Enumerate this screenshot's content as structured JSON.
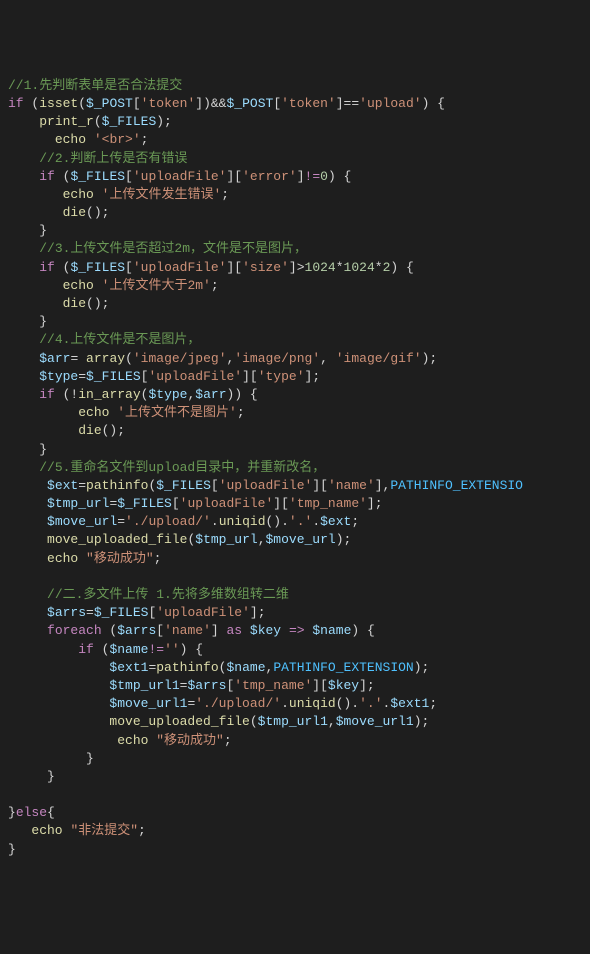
{
  "code": {
    "comments": {
      "c1": "//1.先判断表单是否合法提交",
      "c2": "//2.判断上传是否有错误",
      "c3": "//3.上传文件是否超过2m，文件是不是图片，",
      "c4": "//4.上传文件是不是图片，",
      "c5": "//5.重命名文件到upload目录中，并重新改名，",
      "c6": "//二.多文件上传 1.先将多维数组转二维"
    },
    "kw": {
      "if": "if",
      "else": "else",
      "foreach": "foreach",
      "as": "as",
      "arrow": "=>",
      "noteq": "!="
    },
    "fn": {
      "isset": "isset",
      "print_r": "print_r",
      "echo": "echo",
      "die": "die",
      "array": "array",
      "in_array": "in_array",
      "pathinfo": "pathinfo",
      "uniqid": "uniqid",
      "move_uploaded_file": "move_uploaded_file"
    },
    "vars": {
      "post": "$_POST",
      "files": "$_FILES",
      "arr": "$arr",
      "type": "$type",
      "ext": "$ext",
      "tmp_url": "$tmp_url",
      "move_url": "$move_url",
      "arrs": "$arrs",
      "key": "$key",
      "name": "$name",
      "ext1": "$ext1",
      "tmp_url1": "$tmp_url1",
      "move_url1": "$move_url1"
    },
    "str": {
      "token": "'token'",
      "upload": "'upload'",
      "br": "'<br>'",
      "uploadFile": "'uploadFile'",
      "error": "'error'",
      "errMsg": "'上传文件发生错误'",
      "size": "'size'",
      "sizeMsg": "'上传文件大于2m'",
      "jpeg": "'image/jpeg'",
      "png": "'image/png'",
      "gif": "'image/gif'",
      "typeKey": "'type'",
      "notImg": "'上传文件不是图片'",
      "nameKey": "'name'",
      "tmpName": "'tmp_name'",
      "uploadPath": "'./upload/'",
      "dot": "'.'",
      "moveOk": "\"移动成功\"",
      "empty": "''",
      "illegal": "\"非法提交\""
    },
    "num": {
      "zero": "0",
      "n1024": "1024",
      "n2": "2"
    },
    "const": {
      "pathext": "PATHINFO_EXTENSION",
      "pathext_trunc": "PATHINFO_EXTENSIO"
    }
  }
}
